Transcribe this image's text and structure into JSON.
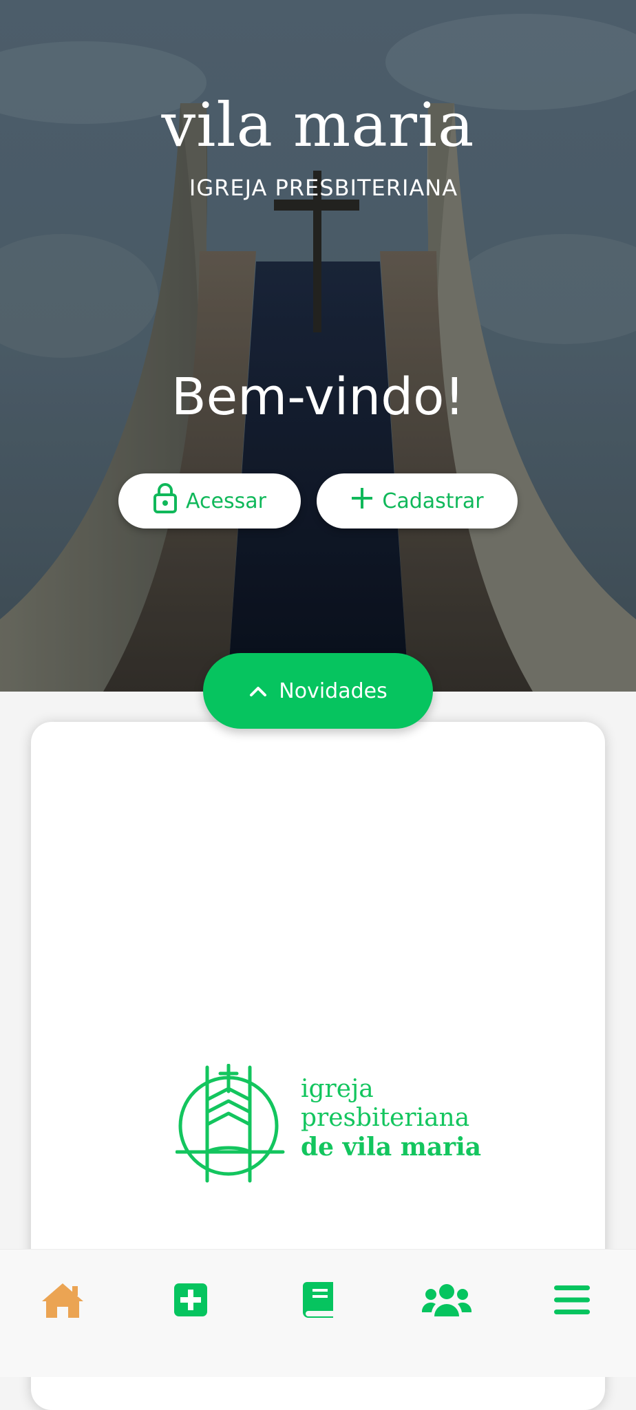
{
  "brand": {
    "title": "vila maria",
    "subtitle": "IGREJA PRESBITERIANA"
  },
  "hero": {
    "welcome": "Bem-vindo!"
  },
  "actions": {
    "login_label": "Acessar",
    "signup_label": "Cadastrar",
    "news_label": "Novidades"
  },
  "logo": {
    "line1": "igreja",
    "line2": "presbiteriana",
    "line3": "de vila maria"
  },
  "bottom_nav": {
    "items": [
      {
        "icon": "home-icon",
        "active": true
      },
      {
        "icon": "plus-square-icon",
        "active": false
      },
      {
        "icon": "book-icon",
        "active": false
      },
      {
        "icon": "users-icon",
        "active": false
      },
      {
        "icon": "menu-icon",
        "active": false
      }
    ]
  },
  "colors": {
    "accent": "#06c45f",
    "active_nav": "#eba453",
    "background": "#f4f4f4"
  }
}
